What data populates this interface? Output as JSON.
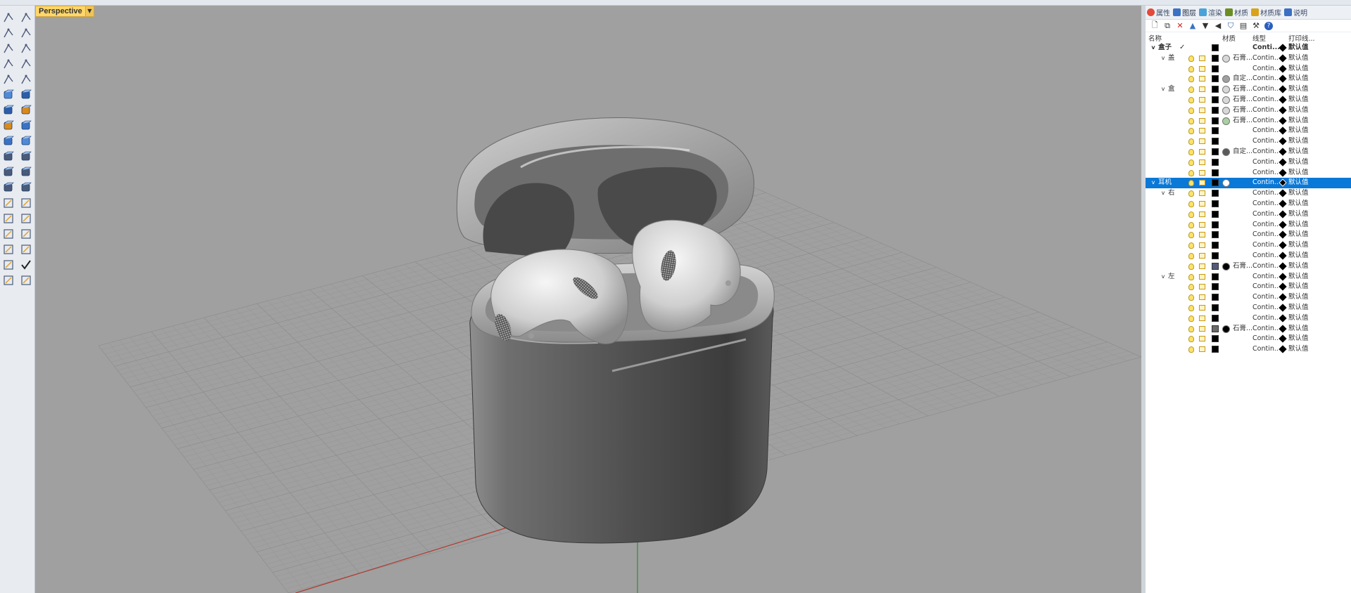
{
  "viewport": {
    "title": "Perspective",
    "dropdown_icon": "chevron-down-icon"
  },
  "panel": {
    "tabs": [
      {
        "label": "属性",
        "icon": "properties-icon"
      },
      {
        "label": "图层",
        "icon": "layers-icon"
      },
      {
        "label": "渲染",
        "icon": "render-icon"
      },
      {
        "label": "材质",
        "icon": "material-icon"
      },
      {
        "label": "材质库",
        "icon": "library-icon"
      },
      {
        "label": "说明",
        "icon": "help-icon"
      }
    ],
    "tools": [
      "new-layer-icon",
      "new-sublayer-icon",
      "delete-icon",
      "move-up-icon",
      "move-down-icon",
      "move-parent-icon",
      "filter-icon",
      "layer-props-icon",
      "tools-icon",
      "question-icon"
    ],
    "columns": {
      "name": "名称",
      "material": "材质",
      "linetype": "线型",
      "print": "打印线..."
    },
    "layers": [
      {
        "name": "盒子",
        "level": 0,
        "expand": "v",
        "current": "✓",
        "material": "",
        "mat_color": "",
        "linetype": "Conti...",
        "print": "默认值",
        "bold": true,
        "swatch": "black",
        "icons": false
      },
      {
        "name": "盖",
        "level": 1,
        "expand": "v",
        "material": "石膏...",
        "mat_color": "#d8d8d8",
        "linetype": "Contin...",
        "print": "默认值",
        "swatch": "black",
        "icons": true
      },
      {
        "name": "",
        "level": 1,
        "material": "",
        "mat_color": "",
        "linetype": "Contin...",
        "print": "默认值",
        "swatch": "black",
        "icons": true
      },
      {
        "name": "",
        "level": 1,
        "material": "自定...",
        "mat_color": "#a0a0a0",
        "linetype": "Contin...",
        "print": "默认值",
        "swatch": "black",
        "icons": true
      },
      {
        "name": "盒",
        "level": 1,
        "expand": "v",
        "material": "石膏...",
        "mat_color": "#d8d8d8",
        "linetype": "Contin...",
        "print": "默认值",
        "swatch": "black",
        "icons": true
      },
      {
        "name": "",
        "level": 1,
        "material": "石膏...",
        "mat_color": "#d8d8d8",
        "linetype": "Contin...",
        "print": "默认值",
        "swatch": "black",
        "icons": true
      },
      {
        "name": "",
        "level": 1,
        "material": "石膏...",
        "mat_color": "#d8d8d8",
        "linetype": "Contin...",
        "print": "默认值",
        "swatch": "black",
        "icons": true
      },
      {
        "name": "",
        "level": 1,
        "material": "石膏...",
        "mat_color": "#a8d0a0",
        "linetype": "Contin...",
        "print": "默认值",
        "swatch": "black",
        "icons": true
      },
      {
        "name": "",
        "level": 1,
        "material": "",
        "mat_color": "",
        "linetype": "Contin...",
        "print": "默认值",
        "swatch": "black",
        "icons": true
      },
      {
        "name": "",
        "level": 1,
        "material": "",
        "mat_color": "",
        "linetype": "Contin...",
        "print": "默认值",
        "swatch": "black",
        "icons": true
      },
      {
        "name": "",
        "level": 1,
        "material": "自定...",
        "mat_color": "#5a5a5a",
        "linetype": "Contin...",
        "print": "默认值",
        "swatch": "black",
        "icons": true
      },
      {
        "name": "",
        "level": 1,
        "material": "",
        "mat_color": "",
        "linetype": "Contin...",
        "print": "默认值",
        "swatch": "black",
        "icons": true
      },
      {
        "name": "",
        "level": 1,
        "material": "",
        "mat_color": "",
        "linetype": "Contin...",
        "print": "默认值",
        "swatch": "black",
        "icons": true
      },
      {
        "name": "耳机",
        "level": 0,
        "expand": "v",
        "material": "",
        "mat_color": "#ffffff",
        "linetype": "Contin...",
        "print": "默认值",
        "swatch": "black",
        "icons": true,
        "selected": true
      },
      {
        "name": "右",
        "level": 1,
        "expand": "v",
        "material": "",
        "mat_color": "",
        "linetype": "Contin...",
        "print": "默认值",
        "swatch": "black",
        "icons": true
      },
      {
        "name": "",
        "level": 1,
        "material": "",
        "mat_color": "",
        "linetype": "Contin...",
        "print": "默认值",
        "swatch": "black",
        "icons": true
      },
      {
        "name": "",
        "level": 1,
        "material": "",
        "mat_color": "",
        "linetype": "Contin...",
        "print": "默认值",
        "swatch": "black",
        "icons": true
      },
      {
        "name": "",
        "level": 1,
        "material": "",
        "mat_color": "",
        "linetype": "Contin...",
        "print": "默认值",
        "swatch": "black",
        "icons": true
      },
      {
        "name": "",
        "level": 1,
        "material": "",
        "mat_color": "",
        "linetype": "Contin...",
        "print": "默认值",
        "swatch": "black",
        "icons": true
      },
      {
        "name": "",
        "level": 1,
        "material": "",
        "mat_color": "",
        "linetype": "Contin...",
        "print": "默认值",
        "swatch": "black",
        "icons": true
      },
      {
        "name": "",
        "level": 1,
        "material": "",
        "mat_color": "",
        "linetype": "Contin...",
        "print": "默认值",
        "swatch": "black",
        "icons": true
      },
      {
        "name": "",
        "level": 1,
        "material": "石膏...",
        "mat_color": "#000000",
        "linetype": "Contin...",
        "print": "默认值",
        "swatch": "blue",
        "icons": true
      },
      {
        "name": "左",
        "level": 1,
        "expand": "v",
        "material": "",
        "mat_color": "",
        "linetype": "Contin...",
        "print": "默认值",
        "swatch": "black",
        "icons": true
      },
      {
        "name": "",
        "level": 1,
        "material": "",
        "mat_color": "",
        "linetype": "Contin...",
        "print": "默认值",
        "swatch": "black",
        "icons": true
      },
      {
        "name": "",
        "level": 1,
        "material": "",
        "mat_color": "",
        "linetype": "Contin...",
        "print": "默认值",
        "swatch": "black",
        "icons": true
      },
      {
        "name": "",
        "level": 1,
        "material": "",
        "mat_color": "",
        "linetype": "Contin...",
        "print": "默认值",
        "swatch": "black",
        "icons": true
      },
      {
        "name": "",
        "level": 1,
        "material": "",
        "mat_color": "",
        "linetype": "Contin...",
        "print": "默认值",
        "swatch": "black",
        "icons": true
      },
      {
        "name": "",
        "level": 1,
        "material": "石膏...",
        "mat_color": "#000000",
        "linetype": "Contin...",
        "print": "默认值",
        "swatch": "grey",
        "icons": true
      },
      {
        "name": "",
        "level": 1,
        "material": "",
        "mat_color": "",
        "linetype": "Contin...",
        "print": "默认值",
        "swatch": "black",
        "icons": true
      },
      {
        "name": "",
        "level": 1,
        "material": "",
        "mat_color": "",
        "linetype": "Contin...",
        "print": "默认值",
        "swatch": "black",
        "icons": true
      }
    ]
  },
  "colors": {
    "viewport_bg": "#a0a0a0",
    "selection": "#0a78d7",
    "tab_accent": "#ffd76b",
    "x_axis": "#b03a2e",
    "y_axis": "#2e8b3a"
  }
}
